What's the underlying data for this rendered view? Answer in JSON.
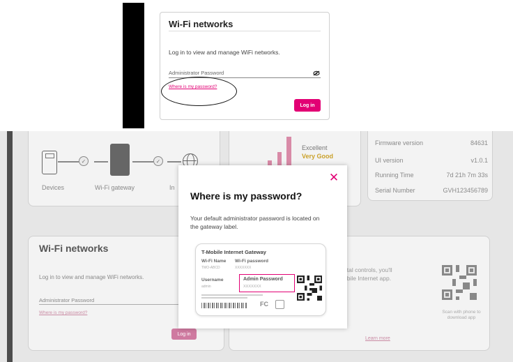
{
  "top_card": {
    "title": "Wi-Fi networks",
    "description": "Log in to view and manage WiFi networks.",
    "password_label": "Administrator Password",
    "help_link": "Where is my password?",
    "login_button": "Log in"
  },
  "dashboard": {
    "network_labels": {
      "devices": "Devices",
      "gateway": "Wi-Fi gateway",
      "internet": "In"
    },
    "signal": {
      "quality": "Excellent",
      "strength": "Very Good"
    },
    "info_rows": [
      {
        "label": "Firmware version",
        "value": "84631"
      },
      {
        "label": "UI version",
        "value": "v1.0.1"
      },
      {
        "label": "Running Time",
        "value": "7d 21h 7m 33s"
      },
      {
        "label": "Serial Number",
        "value": "GVH123456789"
      }
    ],
    "wifi_panel": {
      "title": "Wi-Fi networks",
      "description": "Log in to view and manage WiFi networks.",
      "password_label": "Administrator Password",
      "help_link": "Where is my password?",
      "login_button": "Log in"
    },
    "parental": {
      "line1": "ntal controls, you'll",
      "line2": "obile Internet app.",
      "scan_text": "Scan with phone to download app",
      "learn_more": "Learn more"
    }
  },
  "modal": {
    "title": "Where is my password?",
    "description": "Your default administrator password is located on the gateway label.",
    "label": {
      "brand": "T-Mobile Internet Gateway",
      "wifi_name_key": "Wi-Fi Name",
      "wifi_name_val": "TMO-ABCD",
      "wifi_password_key": "Wi-Fi password",
      "wifi_password_val": "XXXXXXX",
      "username_key": "Username",
      "username_val": "admin",
      "admin_password_key": "Admin Password",
      "admin_password_val": "XXXXXXX",
      "fc_mark": "FC"
    }
  },
  "colors": {
    "accent": "#e20074",
    "faded_accent": "#cf7aa0"
  },
  "icons": [
    "eye-off-icon",
    "close-icon",
    "devices-icon",
    "gateway-icon",
    "globe-icon",
    "check-icon",
    "qr-code-icon",
    "signal-icon"
  ]
}
